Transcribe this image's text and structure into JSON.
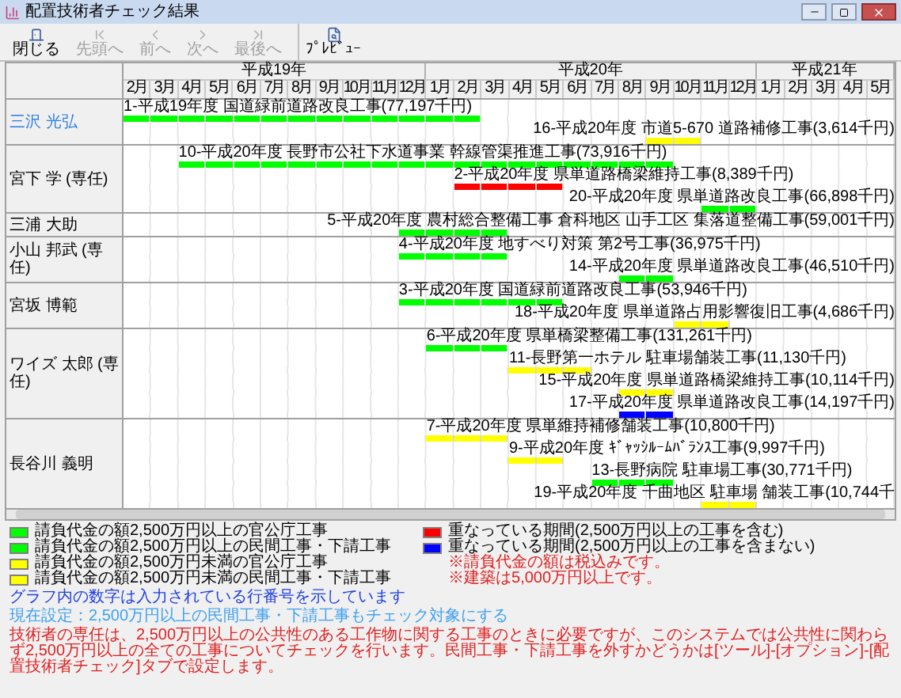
{
  "window": {
    "title": "配置技術者チェック結果"
  },
  "toolbar": [
    {
      "kind": "close",
      "label": "閉じる",
      "disabled": false
    },
    {
      "kind": "first",
      "label": "先頭へ",
      "disabled": true
    },
    {
      "kind": "prev",
      "label": "前へ",
      "disabled": true
    },
    {
      "kind": "next",
      "label": "次へ",
      "disabled": true
    },
    {
      "kind": "last",
      "label": "最後へ",
      "disabled": true
    },
    {
      "kind": "preview",
      "label": "ﾌﾟﾚﾋﾞｭｰ",
      "disabled": false
    }
  ],
  "timeline": {
    "years": [
      {
        "label": "平成19年",
        "months": [
          "2月",
          "3月",
          "4月",
          "5月",
          "6月",
          "7月",
          "8月",
          "9月",
          "10月",
          "11月",
          "12月"
        ]
      },
      {
        "label": "平成20年",
        "months": [
          "1月",
          "2月",
          "3月",
          "4月",
          "5月",
          "6月",
          "7月",
          "8月",
          "9月",
          "10月",
          "11月",
          "12月"
        ]
      },
      {
        "label": "平成21年",
        "months": [
          "1月",
          "2月",
          "3月",
          "4月",
          "5月"
        ]
      }
    ]
  },
  "rows": [
    {
      "name": "三沢 光弘",
      "selected": true,
      "bars": [
        {
          "label": "1-平成19年度 国道緑前道路改良工事(77,197千円)",
          "color": "#00ff00",
          "months": [
            true,
            true,
            true,
            true,
            true,
            true,
            true,
            true,
            true,
            true,
            true,
            true,
            true,
            false,
            false,
            false,
            false,
            false,
            false,
            false,
            false,
            false,
            false,
            false,
            false,
            false,
            false,
            false
          ]
        },
        {
          "label": "16-平成20年度 市道5-670 道路補修工事(3,614千円)",
          "color": "#ffff00",
          "months": [
            false,
            false,
            false,
            false,
            false,
            false,
            false,
            false,
            false,
            false,
            false,
            false,
            false,
            false,
            false,
            false,
            false,
            false,
            false,
            true,
            true,
            false,
            false,
            false,
            false,
            false,
            false,
            false
          ]
        }
      ]
    },
    {
      "name": "宮下 学 (専任)",
      "selected": false,
      "bars": [
        {
          "label": "10-平成20年度 長野市公社下水道事業 幹線管渠推進工事(73,916千円)",
          "color": "#00ff00",
          "months": [
            false,
            false,
            true,
            true,
            true,
            true,
            true,
            true,
            true,
            true,
            true,
            true,
            true,
            true,
            true,
            true,
            true,
            true,
            true,
            true,
            false,
            false,
            false,
            false,
            false,
            false,
            false,
            false
          ]
        },
        {
          "label": "2-平成20年度 県単道路橋梁維持工事(8,389千円)",
          "color": "#ff0000",
          "months": [
            false,
            false,
            false,
            false,
            false,
            false,
            false,
            false,
            false,
            false,
            false,
            false,
            true,
            true,
            true,
            true,
            false,
            false,
            false,
            false,
            false,
            false,
            false,
            false,
            false,
            false,
            false,
            false
          ]
        },
        {
          "label": "20-平成20年度 県単道路改良工事(66,898千円)",
          "color": "#00ff00",
          "months": [
            false,
            false,
            false,
            false,
            false,
            false,
            false,
            false,
            false,
            false,
            false,
            false,
            false,
            false,
            false,
            false,
            false,
            false,
            false,
            false,
            false,
            true,
            true,
            false,
            false,
            false,
            false,
            false
          ]
        }
      ]
    },
    {
      "name": "三浦 大助",
      "selected": false,
      "bars": [
        {
          "label": "5-平成20年度 農村総合整備工事 倉科地区 山手工区 集落道整備工事(59,001千円)",
          "color": "#00ff00",
          "months": [
            false,
            false,
            false,
            false,
            false,
            false,
            false,
            false,
            false,
            false,
            true,
            true,
            true,
            true,
            false,
            false,
            false,
            false,
            false,
            false,
            false,
            false,
            false,
            false,
            false,
            false,
            false,
            false
          ]
        }
      ]
    },
    {
      "name": "小山 邦武 (専任)",
      "selected": false,
      "bars": [
        {
          "label": "4-平成20年度 地すべり対策 第2号工事(36,975千円)",
          "color": "#00ff00",
          "months": [
            false,
            false,
            false,
            false,
            false,
            false,
            false,
            false,
            false,
            false,
            true,
            true,
            true,
            true,
            false,
            false,
            false,
            false,
            false,
            false,
            false,
            false,
            false,
            false,
            false,
            false,
            false,
            false
          ]
        },
        {
          "label": "14-平成20年度 県単道路改良工事(46,510千円)",
          "color": "#00ff00",
          "months": [
            false,
            false,
            false,
            false,
            false,
            false,
            false,
            false,
            false,
            false,
            false,
            false,
            false,
            false,
            false,
            false,
            false,
            false,
            true,
            true,
            false,
            false,
            false,
            false,
            false,
            false,
            false,
            false
          ]
        }
      ]
    },
    {
      "name": "宮坂 博範",
      "selected": false,
      "bars": [
        {
          "label": "3-平成20年度 国道緑前道路改良工事(53,946千円)",
          "color": "#00ff00",
          "months": [
            false,
            false,
            false,
            false,
            false,
            false,
            false,
            false,
            false,
            false,
            true,
            true,
            true,
            true,
            true,
            true,
            false,
            false,
            false,
            false,
            false,
            false,
            false,
            false,
            false,
            false,
            false,
            false
          ]
        },
        {
          "label": "18-平成20年度 県単道路占用影響復旧工事(4,686千円)",
          "color": "#ffff00",
          "months": [
            false,
            false,
            false,
            false,
            false,
            false,
            false,
            false,
            false,
            false,
            false,
            false,
            false,
            false,
            false,
            false,
            false,
            false,
            false,
            false,
            true,
            true,
            false,
            false,
            false,
            false,
            false,
            false
          ]
        }
      ]
    },
    {
      "name": "ワイズ 太郎 (専任)",
      "selected": false,
      "bars": [
        {
          "label": "6-平成20年度 県単橋梁整備工事(131,261千円)",
          "color": "#00ff00",
          "months": [
            false,
            false,
            false,
            false,
            false,
            false,
            false,
            false,
            false,
            false,
            false,
            true,
            true,
            true,
            false,
            false,
            false,
            false,
            false,
            false,
            false,
            false,
            false,
            false,
            false,
            false,
            false,
            false
          ]
        },
        {
          "label": "11-長野第一ホテル 駐車場舗装工事(11,130千円)",
          "color": "#ffff00",
          "months": [
            false,
            false,
            false,
            false,
            false,
            false,
            false,
            false,
            false,
            false,
            false,
            false,
            false,
            false,
            true,
            true,
            true,
            false,
            false,
            false,
            false,
            false,
            false,
            false,
            false,
            false,
            false,
            false
          ]
        },
        {
          "label": "15-平成20年度 県単道路橋梁維持工事(10,114千円)",
          "color": "#ffff00",
          "months": [
            false,
            false,
            false,
            false,
            false,
            false,
            false,
            false,
            false,
            false,
            false,
            false,
            false,
            false,
            false,
            false,
            false,
            false,
            true,
            true,
            false,
            false,
            false,
            false,
            false,
            false,
            false,
            false
          ]
        },
        {
          "label": "17-平成20年度 県単道路改良工事(14,197千円)",
          "color": "#0000ff",
          "months": [
            false,
            false,
            false,
            false,
            false,
            false,
            false,
            false,
            false,
            false,
            false,
            false,
            false,
            false,
            false,
            false,
            false,
            false,
            true,
            true,
            false,
            false,
            false,
            false,
            false,
            false,
            false,
            false
          ]
        }
      ]
    },
    {
      "name": "長谷川 義明",
      "selected": false,
      "bars": [
        {
          "label": "7-平成20年度 県単維持補修舗装工事(10,800千円)",
          "color": "#ffff00",
          "months": [
            false,
            false,
            false,
            false,
            false,
            false,
            false,
            false,
            false,
            false,
            false,
            true,
            true,
            true,
            false,
            false,
            false,
            false,
            false,
            false,
            false,
            false,
            false,
            false,
            false,
            false,
            false,
            false
          ]
        },
        {
          "label": "9-平成20年度 ｷﾞｬｯｼﾙｰﾑﾊﾞﾗﾝｽ工事(9,997千円)",
          "color": "#ffff00",
          "months": [
            false,
            false,
            false,
            false,
            false,
            false,
            false,
            false,
            false,
            false,
            false,
            false,
            false,
            false,
            true,
            true,
            false,
            false,
            false,
            false,
            false,
            false,
            false,
            false,
            false,
            false,
            false,
            false
          ]
        },
        {
          "label": "13-長野病院 駐車場工事(30,771千円)",
          "color": "#00ff00",
          "months": [
            false,
            false,
            false,
            false,
            false,
            false,
            false,
            false,
            false,
            false,
            false,
            false,
            false,
            false,
            false,
            false,
            false,
            true,
            true,
            true,
            false,
            false,
            false,
            false,
            false,
            false,
            false,
            false
          ]
        },
        {
          "label": "19-平成20年度 千曲地区 駐車場 舗装工事(10,744千",
          "color": "#ffff00",
          "months": [
            false,
            false,
            false,
            false,
            false,
            false,
            false,
            false,
            false,
            false,
            false,
            false,
            false,
            false,
            false,
            false,
            false,
            false,
            false,
            false,
            false,
            true,
            true,
            false,
            false,
            false,
            false,
            false
          ]
        }
      ]
    }
  ],
  "legend": [
    {
      "label": "請負代金の額2,500万円以上の官公庁工事",
      "color": "#00ff00"
    },
    {
      "label": "請負代金の額2,500万円以上の民間工事・下請工事",
      "color": "#00ff00"
    },
    {
      "label": "請負代金の額2,500万円未満の官公庁工事",
      "color": "#ffff00"
    },
    {
      "label": "請負代金の額2,500万円未満の民間工事・下請工事",
      "color": "#ffff00"
    }
  ],
  "overlap_legend": [
    {
      "label": "重なっている期間(2,500万円以上の工事を含む)",
      "color": "#ff0000"
    },
    {
      "label": "重なっている期間(2,500万円以上の工事を含まない)",
      "color": "#0000ff"
    }
  ],
  "notes": [
    "※請負代金の額は税込みです。",
    "※建築は5,000万円以上です。"
  ],
  "info": "グラフ内の数字は入力されている行番号を示しています",
  "setting": "現在設定：2,500万円以上の民間工事・下請工事もチェック対象にする",
  "explanation": "技術者の専任は、2,500万円以上の公共性のある工作物に関する工事のときに必要ですが、このシステムでは公共性に関わらず2,500万円以上の全ての工事についてチェックを行います。民間工事・下請工事を外すかどうかは[ツール]-[オプション]-[配置技術者チェック]タブで設定します。"
}
